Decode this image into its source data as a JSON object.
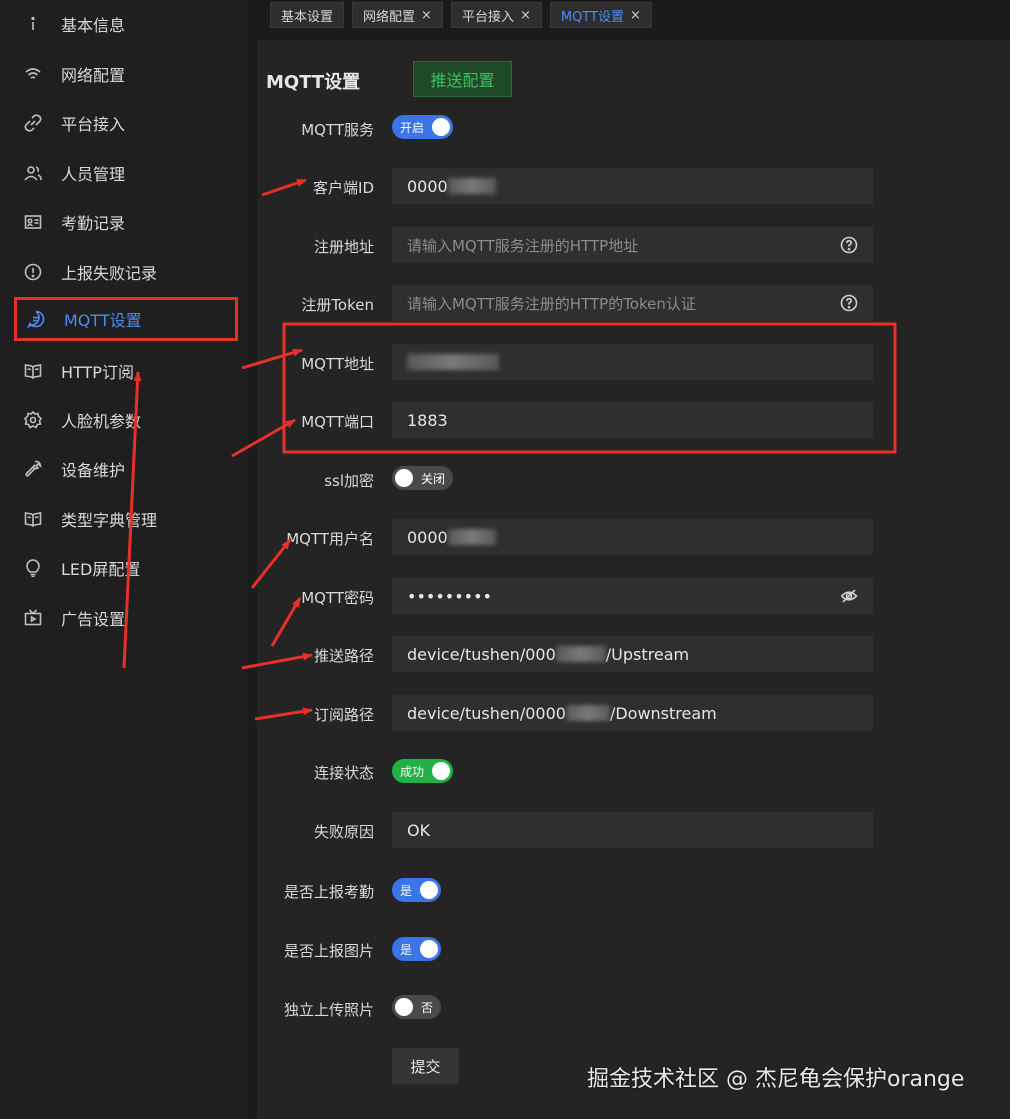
{
  "sidebar": {
    "items": [
      {
        "label": "基本信息",
        "icon": "info-icon"
      },
      {
        "label": "网络配置",
        "icon": "wifi-icon"
      },
      {
        "label": "平台接入",
        "icon": "link-icon"
      },
      {
        "label": "人员管理",
        "icon": "users-icon"
      },
      {
        "label": "考勤记录",
        "icon": "id-card-icon"
      },
      {
        "label": "上报失败记录",
        "icon": "alert-circle-icon"
      },
      {
        "label": "MQTT设置",
        "icon": "chat-icon",
        "active": true
      },
      {
        "label": "HTTP订阅",
        "icon": "book-icon"
      },
      {
        "label": "人脸机参数",
        "icon": "gear-icon"
      },
      {
        "label": "设备维护",
        "icon": "wrench-icon"
      },
      {
        "label": "类型字典管理",
        "icon": "book-icon"
      },
      {
        "label": "LED屏配置",
        "icon": "bulb-icon"
      },
      {
        "label": "广告设置",
        "icon": "tv-icon"
      }
    ]
  },
  "tabs": [
    {
      "label": "基本设置",
      "closable": false
    },
    {
      "label": "网络配置",
      "closable": true
    },
    {
      "label": "平台接入",
      "closable": true
    },
    {
      "label": "MQTT设置",
      "closable": true,
      "active": true
    }
  ],
  "tab_close_glyph": "×",
  "page": {
    "title": "MQTT设置",
    "push_button": "推送配置"
  },
  "form": {
    "mqtt_service": {
      "label": "MQTT服务",
      "state": "开启"
    },
    "client_id": {
      "label": "客户端ID",
      "value": "0000"
    },
    "register_url": {
      "label": "注册地址",
      "placeholder": "请输入MQTT服务注册的HTTP地址"
    },
    "register_token": {
      "label": "注册Token",
      "placeholder": "请输入MQTT服务注册的HTTP的Token认证"
    },
    "mqtt_address": {
      "label": "MQTT地址",
      "value": ""
    },
    "mqtt_port": {
      "label": "MQTT端口",
      "value": "1883"
    },
    "ssl": {
      "label": "ssl加密",
      "state": "关闭"
    },
    "username": {
      "label": "MQTT用户名",
      "value": "0000"
    },
    "password": {
      "label": "MQTT密码",
      "value": "•••••••••"
    },
    "push_path": {
      "label": "推送路径",
      "prefix": "device/tushen/000",
      "suffix": "/Upstream"
    },
    "sub_path": {
      "label": "订阅路径",
      "prefix": "device/tushen/0000",
      "suffix": "/Downstream"
    },
    "conn_status": {
      "label": "连接状态",
      "state": "成功"
    },
    "fail_reason": {
      "label": "失败原因",
      "value": "OK"
    },
    "report_attendance": {
      "label": "是否上报考勤",
      "state": "是"
    },
    "report_image": {
      "label": "是否上报图片",
      "state": "是"
    },
    "upload_photo": {
      "label": "独立上传照片",
      "state": "否"
    },
    "submit": "提交"
  },
  "watermark": "掘金技术社区 @ 杰尼龟会保护orange",
  "colors": {
    "accent": "#4d8cf5",
    "success": "#22b048",
    "annotation": "#e8302a"
  }
}
